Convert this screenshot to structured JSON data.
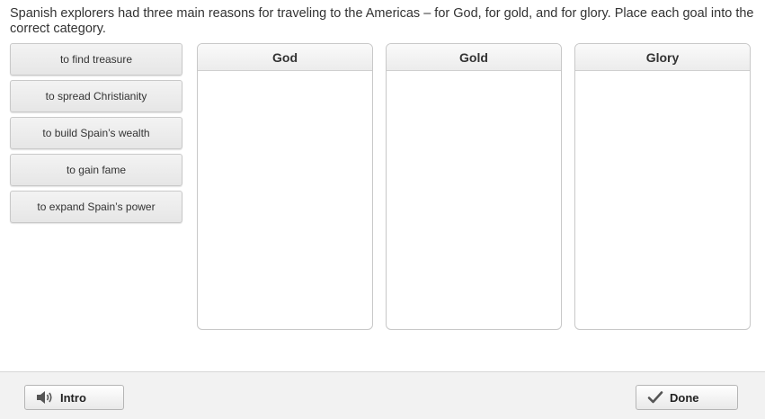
{
  "prompt": "Spanish explorers had three main reasons for traveling to the Americas – for God, for gold, and for glory. Place each goal into the correct category.",
  "tiles": [
    {
      "label": "to find treasure"
    },
    {
      "label": "to spread Christianity"
    },
    {
      "label": "to build Spain’s wealth"
    },
    {
      "label": "to gain fame"
    },
    {
      "label": "to expand Spain’s power"
    }
  ],
  "categories": [
    {
      "label": "God"
    },
    {
      "label": "Gold"
    },
    {
      "label": "Glory"
    }
  ],
  "footer": {
    "intro_label": "Intro",
    "intro_icon": "speaker-icon",
    "done_label": "Done",
    "done_icon": "checkmark-icon"
  }
}
